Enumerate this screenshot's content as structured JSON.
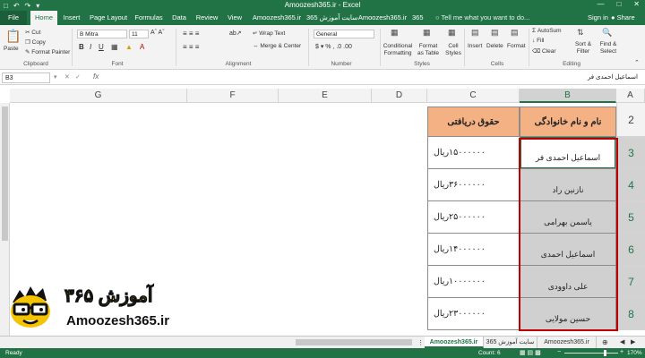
{
  "window": {
    "title": "Amoozesh365.ir - Excel",
    "qat_icons": [
      "save-icon",
      "undo-icon",
      "redo-icon",
      "customize-icon"
    ],
    "controls": [
      "minimize-icon",
      "restore-icon",
      "close-icon"
    ]
  },
  "tabs": [
    {
      "label": "File"
    },
    {
      "label": "Home"
    },
    {
      "label": "Insert"
    },
    {
      "label": "Page Layout"
    },
    {
      "label": "Formulas"
    },
    {
      "label": "Data"
    },
    {
      "label": "Review"
    },
    {
      "label": "View"
    },
    {
      "label": "Amoozesh365.ir"
    },
    {
      "label": "سایت آموزش 365"
    },
    {
      "label": "Amoozesh365.ir"
    },
    {
      "label": "سایت آموزش 365"
    }
  ],
  "tellme": "Tell me what you want to do...",
  "signin": "Sign in",
  "share": "Share",
  "ribbon": {
    "clipboard": {
      "paste": "Paste",
      "cut": "Cut",
      "copy": "Copy",
      "format_painter": "Format Painter",
      "label": "Clipboard"
    },
    "font": {
      "name": "B Mitra",
      "size": "11",
      "label": "Font"
    },
    "alignment": {
      "wrap": "Wrap Text",
      "merge": "Merge & Center",
      "label": "Alignment"
    },
    "number": {
      "format": "General",
      "label": "Number"
    },
    "styles": {
      "conditional": "Conditional Formatting",
      "format_table": "Format as Table",
      "cell_styles": "Cell Styles",
      "label": "Styles"
    },
    "cells": {
      "insert": "Insert",
      "delete": "Delete",
      "format": "Format",
      "label": "Cells"
    },
    "editing": {
      "autosum": "AutoSum",
      "fill": "Fill",
      "clear": "Clear",
      "sort": "Sort & Filter",
      "find": "Find & Select",
      "label": "Editing"
    }
  },
  "formula_bar": {
    "name_box": "B3",
    "fx": "fx",
    "content": "اسماعیل احمدی فر"
  },
  "columns": [
    "G",
    "F",
    "E",
    "D",
    "C",
    "B",
    "A"
  ],
  "rows": [
    "2",
    "3",
    "4",
    "5",
    "6",
    "7",
    "8"
  ],
  "table": {
    "header_name": "نام و نام خانوادگی",
    "header_salary": "حقوق دریافتی",
    "rows": [
      {
        "name": "اسماعیل احمدی فر",
        "salary": "۱۵۰۰۰۰۰۰ریال"
      },
      {
        "name": "نازنین راد",
        "salary": "۳۶۰۰۰۰۰۰ریال"
      },
      {
        "name": "یاسمن بهرامی",
        "salary": "۲۵۰۰۰۰۰۰ریال"
      },
      {
        "name": "اسماعیل احمدی",
        "salary": "۱۴۰۰۰۰۰۰ریال"
      },
      {
        "name": "علی داوودی",
        "salary": "۱۰۰۰۰۰۰۰ریال"
      },
      {
        "name": "حسین مولایی",
        "salary": "۲۳۰۰۰۰۰۰ریال"
      }
    ]
  },
  "logo": {
    "persian": "آموزش ۳۶۵",
    "url": "Amoozesh365.ir",
    "accent": "#f5c400"
  },
  "sheets": [
    {
      "label": "Amoozesh365.ir"
    },
    {
      "label": "سایت آموزش 365"
    },
    {
      "label": "Amoozesh365.ir"
    }
  ],
  "status": {
    "ready": "Ready",
    "count": "Count: 6",
    "zoom": "170%"
  },
  "colors": {
    "excel_green": "#217346",
    "header_fill": "#f4b183",
    "name_fill": "#d0d0d0",
    "selection_border": "#c00000"
  }
}
